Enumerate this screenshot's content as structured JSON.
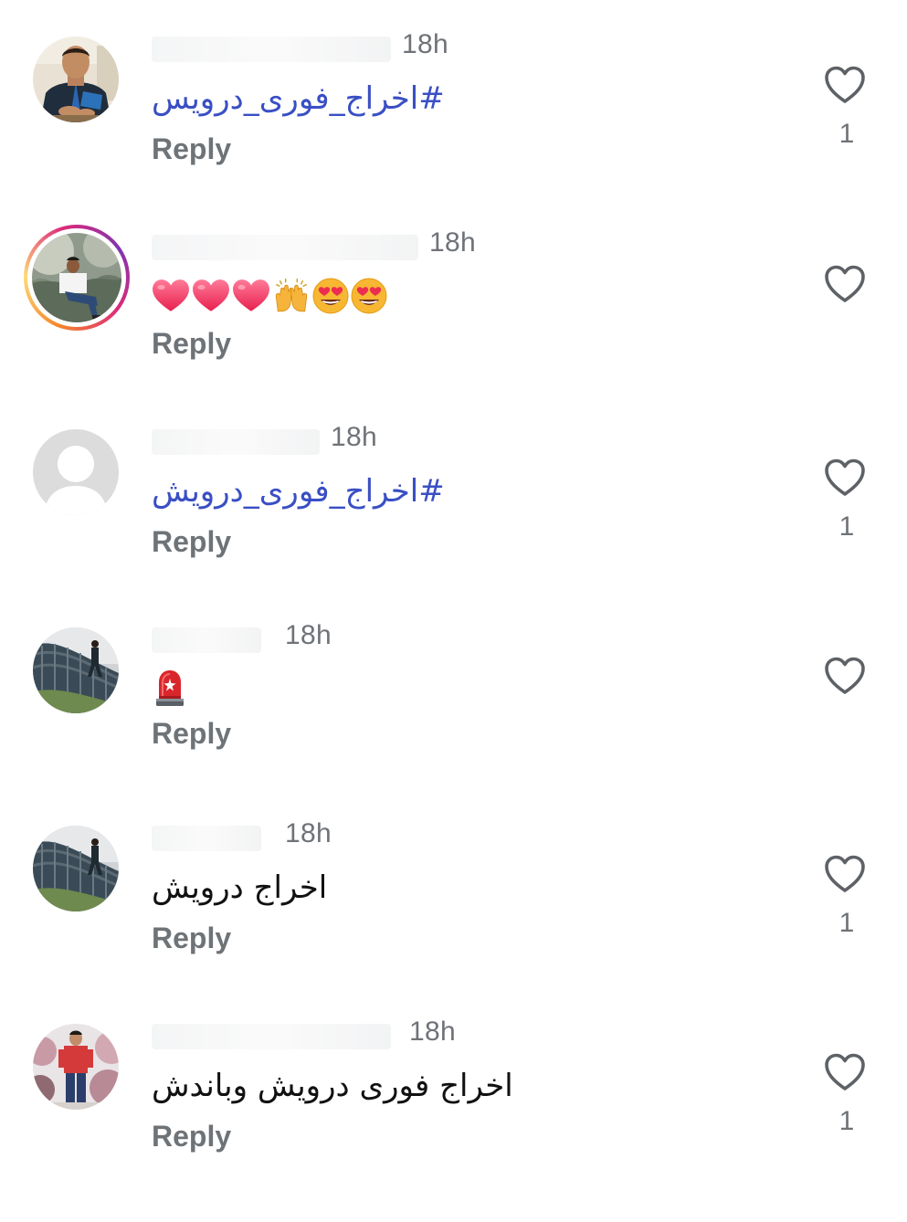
{
  "colors": {
    "hashtag": "#3a4fc4",
    "meta_text": "#6e7377",
    "heart_outline": "#5e6266",
    "emoji_heart": "#f0416c"
  },
  "comments": [
    {
      "time": "18h",
      "text": "#اخراج_فوری_درویس",
      "is_hashtag": true,
      "reply_label": "Reply",
      "like_count": "1",
      "avatar": "user-photo-avatar"
    },
    {
      "time": "18h",
      "text": "",
      "emojis": [
        "red-heart-icon",
        "red-heart-icon",
        "red-heart-icon",
        "raising-hands-icon",
        "heart-eyes-icon",
        "heart-eyes-icon"
      ],
      "reply_label": "Reply",
      "like_count": "",
      "avatar": "story-ring-avatar"
    },
    {
      "time": "18h",
      "text": "#اخراج_فوری_درویش",
      "is_hashtag": true,
      "reply_label": "Reply",
      "like_count": "1",
      "avatar": "default-avatar"
    },
    {
      "time": "18h",
      "text": "",
      "emojis": [
        "siren-icon"
      ],
      "reply_label": "Reply",
      "like_count": "",
      "avatar": "bridge-photo-avatar"
    },
    {
      "time": "18h",
      "text": "اخراج درویش",
      "is_hashtag": false,
      "reply_label": "Reply",
      "like_count": "1",
      "avatar": "bridge-photo-avatar"
    },
    {
      "time": "18h",
      "text": "اخراج فوری درویش وباندش",
      "is_hashtag": false,
      "reply_label": "Reply",
      "like_count": "1",
      "avatar": "red-shirt-photo-avatar"
    }
  ]
}
